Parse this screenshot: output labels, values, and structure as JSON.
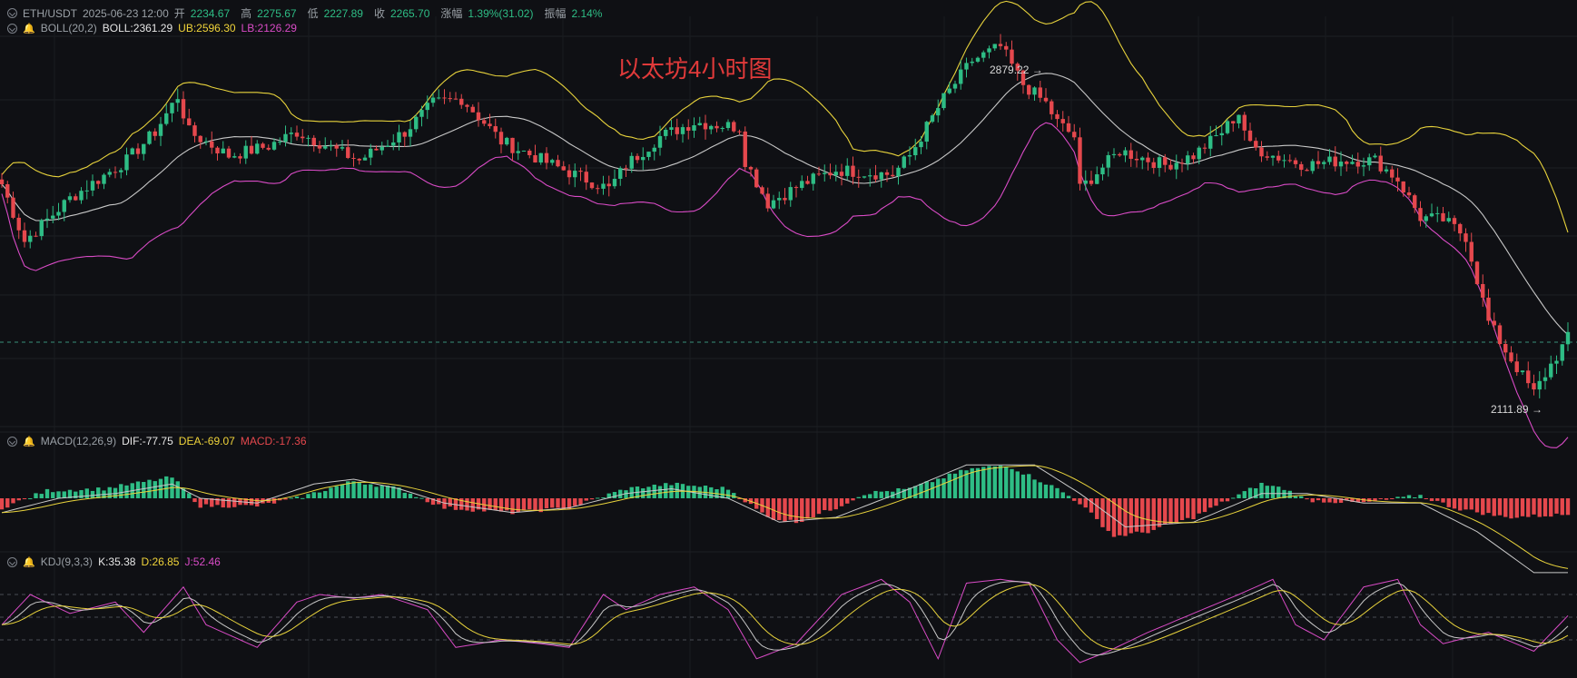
{
  "header": {
    "symbol": "ETH/USDT",
    "datetime": "2025-06-23 12:00",
    "open_label": "开",
    "open": "2234.67",
    "high_label": "高",
    "high": "2275.67",
    "low_label": "低",
    "low": "2227.89",
    "close_label": "收",
    "close": "2265.70",
    "change_label": "涨幅",
    "change": "1.39%(31.02)",
    "amp_label": "振幅",
    "amp": "2.14%"
  },
  "boll": {
    "name": "BOLL(20,2)",
    "boll": "BOLL:2361.29",
    "ub": "UB:2596.30",
    "lb": "LB:2126.29"
  },
  "macd": {
    "name": "MACD(12,26,9)",
    "dif": "DIF:-77.75",
    "dea": "DEA:-69.07",
    "macd": "MACD:-17.36"
  },
  "kdj": {
    "name": "KDJ(9,3,3)",
    "k": "K:35.38",
    "d": "D:26.85",
    "j": "J:52.46"
  },
  "annotations": {
    "title": "以太坊4小时图",
    "high_mark": "2879.22",
    "low_mark": "2111.89"
  },
  "colors": {
    "up": "#2ebd85",
    "down": "#e5484d",
    "boll_mid": "#c8c8c8",
    "boll_ub": "#e8d33c",
    "boll_lb": "#d94bc6",
    "kdj_k": "#c8c8c8",
    "kdj_d": "#e8d33c",
    "kdj_j": "#d94bc6",
    "bg": "#0f1014"
  },
  "chart_data": {
    "type": "candlestick",
    "symbol": "ETH/USDT",
    "interval": "4h",
    "ylim": [
      2080,
      2920
    ],
    "price_key_points": [
      [
        0,
        2590
      ],
      [
        4,
        2470
      ],
      [
        12,
        2560
      ],
      [
        22,
        2640
      ],
      [
        27,
        2700
      ],
      [
        31,
        2775
      ],
      [
        33,
        2700
      ],
      [
        40,
        2650
      ],
      [
        47,
        2670
      ],
      [
        52,
        2700
      ],
      [
        60,
        2655
      ],
      [
        63,
        2640
      ],
      [
        71,
        2700
      ],
      [
        76,
        2760
      ],
      [
        81,
        2770
      ],
      [
        85,
        2720
      ],
      [
        88,
        2680
      ],
      [
        98,
        2625
      ],
      [
        103,
        2600
      ],
      [
        107,
        2580
      ],
      [
        110,
        2630
      ],
      [
        116,
        2690
      ],
      [
        122,
        2720
      ],
      [
        130,
        2710
      ],
      [
        131,
        2640
      ],
      [
        135,
        2550
      ],
      [
        141,
        2590
      ],
      [
        147,
        2620
      ],
      [
        157,
        2610
      ],
      [
        160,
        2650
      ],
      [
        166,
        2770
      ],
      [
        171,
        2850
      ],
      [
        176,
        2879
      ],
      [
        180,
        2800
      ],
      [
        184,
        2760
      ],
      [
        186,
        2720
      ],
      [
        189,
        2690
      ],
      [
        190,
        2580
      ],
      [
        197,
        2660
      ],
      [
        205,
        2630
      ],
      [
        210,
        2650
      ],
      [
        215,
        2700
      ],
      [
        218,
        2740
      ],
      [
        220,
        2670
      ],
      [
        224,
        2650
      ],
      [
        230,
        2630
      ],
      [
        236,
        2640
      ],
      [
        242,
        2640
      ],
      [
        246,
        2600
      ],
      [
        250,
        2520
      ],
      [
        254,
        2515
      ],
      [
        258,
        2480
      ],
      [
        262,
        2300
      ],
      [
        265,
        2240
      ],
      [
        270,
        2150
      ],
      [
        273,
        2210
      ],
      [
        276,
        2266
      ]
    ],
    "macd_hist_key_points": [
      [
        0,
        -10
      ],
      [
        8,
        8
      ],
      [
        18,
        10
      ],
      [
        30,
        22
      ],
      [
        35,
        -8
      ],
      [
        45,
        -8
      ],
      [
        52,
        0
      ],
      [
        62,
        18
      ],
      [
        70,
        10
      ],
      [
        78,
        -10
      ],
      [
        90,
        -15
      ],
      [
        100,
        -10
      ],
      [
        110,
        10
      ],
      [
        118,
        15
      ],
      [
        128,
        10
      ],
      [
        135,
        -20
      ],
      [
        140,
        -25
      ],
      [
        147,
        -10
      ],
      [
        152,
        5
      ],
      [
        160,
        10
      ],
      [
        170,
        30
      ],
      [
        177,
        35
      ],
      [
        186,
        10
      ],
      [
        190,
        -5
      ],
      [
        196,
        -40
      ],
      [
        202,
        -35
      ],
      [
        210,
        -20
      ],
      [
        215,
        -5
      ],
      [
        222,
        15
      ],
      [
        226,
        10
      ],
      [
        230,
        -2
      ],
      [
        240,
        -5
      ],
      [
        250,
        3
      ],
      [
        256,
        -10
      ],
      [
        265,
        -20
      ],
      [
        276,
        -17
      ]
    ],
    "macd_dif_key_points": [
      [
        0,
        -15
      ],
      [
        10,
        0
      ],
      [
        20,
        5
      ],
      [
        30,
        15
      ],
      [
        35,
        0
      ],
      [
        45,
        -5
      ],
      [
        55,
        15
      ],
      [
        62,
        20
      ],
      [
        70,
        10
      ],
      [
        78,
        -5
      ],
      [
        90,
        -15
      ],
      [
        100,
        -10
      ],
      [
        110,
        5
      ],
      [
        118,
        10
      ],
      [
        128,
        0
      ],
      [
        137,
        -25
      ],
      [
        147,
        -20
      ],
      [
        160,
        10
      ],
      [
        170,
        35
      ],
      [
        182,
        35
      ],
      [
        190,
        5
      ],
      [
        198,
        -30
      ],
      [
        210,
        -25
      ],
      [
        222,
        5
      ],
      [
        230,
        5
      ],
      [
        240,
        -5
      ],
      [
        250,
        -5
      ],
      [
        260,
        -35
      ],
      [
        270,
        -78
      ],
      [
        276,
        -78
      ]
    ],
    "kdj_j_key_points": [
      [
        0,
        40
      ],
      [
        5,
        80
      ],
      [
        12,
        55
      ],
      [
        20,
        70
      ],
      [
        25,
        30
      ],
      [
        32,
        90
      ],
      [
        36,
        40
      ],
      [
        45,
        10
      ],
      [
        52,
        70
      ],
      [
        56,
        80
      ],
      [
        62,
        75
      ],
      [
        67,
        80
      ],
      [
        75,
        60
      ],
      [
        80,
        10
      ],
      [
        88,
        20
      ],
      [
        95,
        15
      ],
      [
        100,
        10
      ],
      [
        106,
        80
      ],
      [
        110,
        60
      ],
      [
        116,
        80
      ],
      [
        122,
        90
      ],
      [
        128,
        60
      ],
      [
        133,
        -5
      ],
      [
        140,
        15
      ],
      [
        148,
        80
      ],
      [
        155,
        100
      ],
      [
        160,
        70
      ],
      [
        165,
        -5
      ],
      [
        170,
        95
      ],
      [
        176,
        100
      ],
      [
        181,
        95
      ],
      [
        186,
        20
      ],
      [
        190,
        -10
      ],
      [
        195,
        5
      ],
      [
        202,
        30
      ],
      [
        210,
        55
      ],
      [
        218,
        80
      ],
      [
        224,
        100
      ],
      [
        228,
        40
      ],
      [
        233,
        20
      ],
      [
        240,
        90
      ],
      [
        246,
        100
      ],
      [
        250,
        40
      ],
      [
        254,
        15
      ],
      [
        262,
        30
      ],
      [
        270,
        5
      ],
      [
        276,
        52
      ]
    ]
  }
}
